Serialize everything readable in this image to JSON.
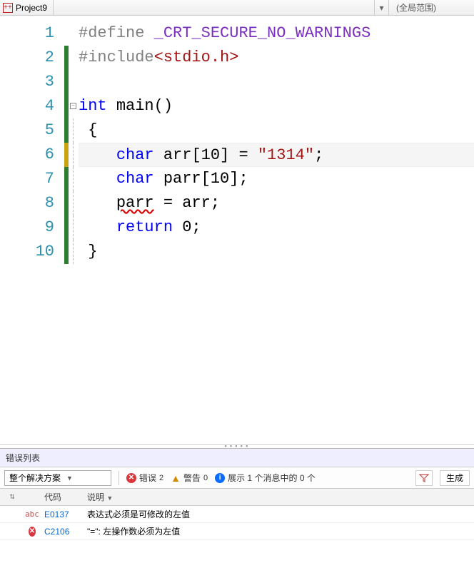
{
  "tab": {
    "title": "Project9"
  },
  "scope": {
    "label": "(全局范围)"
  },
  "code": {
    "lines": [
      {
        "n": "1"
      },
      {
        "n": "2"
      },
      {
        "n": "3"
      },
      {
        "n": "4"
      },
      {
        "n": "5"
      },
      {
        "n": "6"
      },
      {
        "n": "7"
      },
      {
        "n": "8"
      },
      {
        "n": "9"
      },
      {
        "n": "10"
      }
    ],
    "tok": {
      "define": "#define",
      "macro": "_CRT_SECURE_NO_WARNINGS",
      "include": "#include",
      "stdio_open": "<stdio.h>",
      "kw_int": "int",
      "fn_main": "main",
      "parens": "()",
      "brace_open": "{",
      "kw_char": "char",
      "arr_name": "arr",
      "arr_dim": "[10]",
      "eq": " = ",
      "str_1314": "\"1314\"",
      "semi": ";",
      "parr_name": "parr",
      "parr_dim": "[10]",
      "assign_lhs": "parr",
      "assign_rest": " = arr;",
      "kw_return": "return",
      "zero": " 0;",
      "brace_close": "}"
    }
  },
  "panel": {
    "title": "错误列表",
    "combo": "整个解决方案",
    "errors_label": "错误",
    "errors_count": "2",
    "warn_label": "警告",
    "warn_count": "0",
    "info_text": "展示 1 个消息中的 0 个",
    "build_btn": "生成",
    "headers": {
      "code": "代码",
      "desc": "说明"
    },
    "rows": [
      {
        "icon": "abc",
        "code": "E0137",
        "desc": "表达式必须是可修改的左值"
      },
      {
        "icon": "err",
        "code": "C2106",
        "desc": "\"=\": 左操作数必须为左值"
      }
    ]
  }
}
